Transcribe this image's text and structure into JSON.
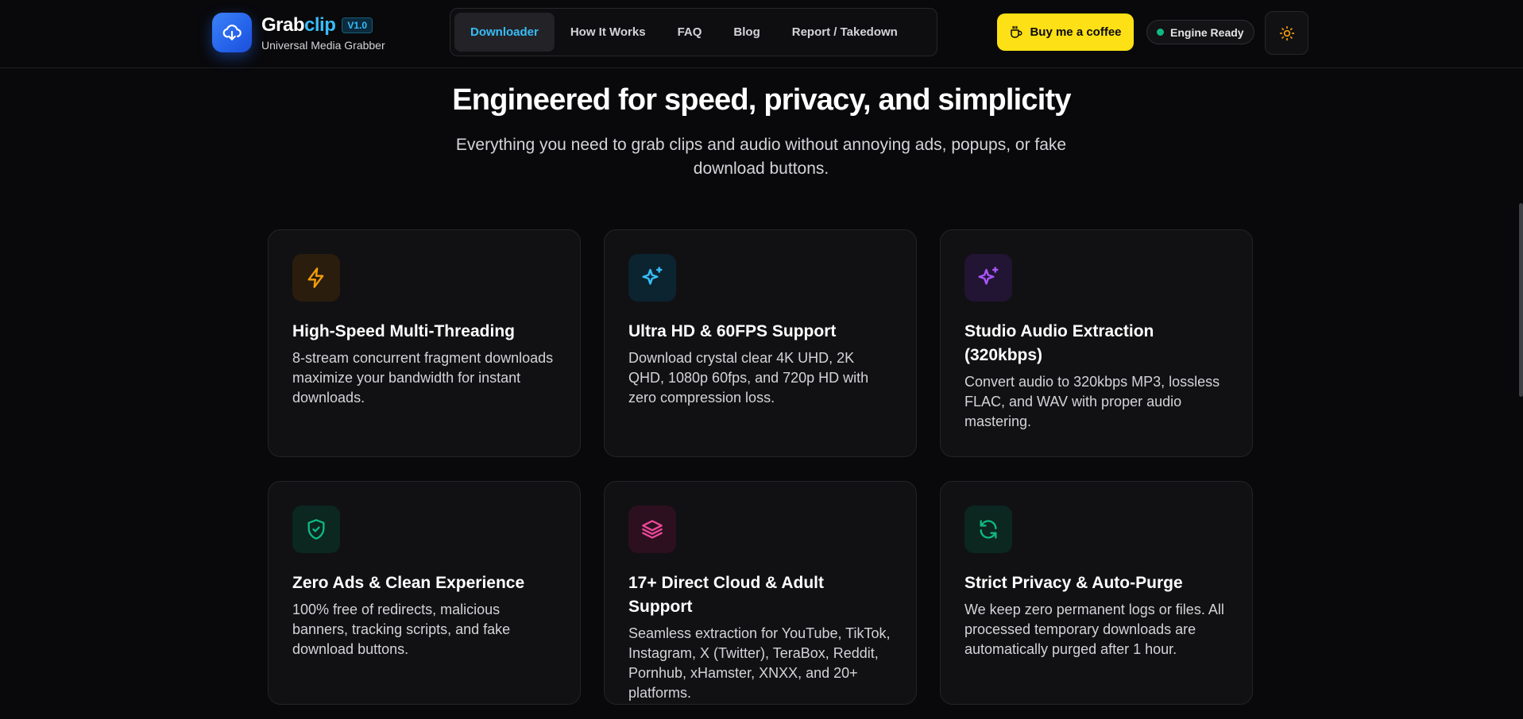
{
  "header": {
    "brand_name_part1": "Grab",
    "brand_name_part2": "clip",
    "version": "V1.0",
    "tagline": "Universal Media Grabber",
    "nav": [
      {
        "label": "Downloader",
        "active": true
      },
      {
        "label": "How It Works",
        "active": false
      },
      {
        "label": "FAQ",
        "active": false
      },
      {
        "label": "Blog",
        "active": false
      },
      {
        "label": "Report / Takedown",
        "active": false
      }
    ],
    "coffee_label": "Buy me a coffee",
    "engine_status": "Engine Ready"
  },
  "hero": {
    "title": "Engineered for speed, privacy, and simplicity",
    "subtitle": "Everything you need to grab clips and audio without annoying ads, popups, or fake download buttons."
  },
  "features": [
    {
      "icon": "lightning-icon",
      "color": "#f59e0b",
      "title": "High-Speed Multi-Threading",
      "desc": "8-stream concurrent fragment downloads maximize your bandwidth for instant downloads."
    },
    {
      "icon": "sparkles-icon",
      "color": "#38bdf8",
      "title": "Ultra HD & 60FPS Support",
      "desc": "Download crystal clear 4K UHD, 2K QHD, 1080p 60fps, and 720p HD with zero compression loss."
    },
    {
      "icon": "sparkles-icon",
      "color": "#a855f7",
      "title": "Studio Audio Extraction (320kbps)",
      "desc": "Convert audio to 320kbps MP3, lossless FLAC, and WAV with proper audio mastering."
    },
    {
      "icon": "shield-check-icon",
      "color": "#10b981",
      "title": "Zero Ads & Clean Experience",
      "desc": "100% free of redirects, malicious banners, tracking scripts, and fake download buttons."
    },
    {
      "icon": "layers-icon",
      "color": "#ec4899",
      "title": "17+ Direct Cloud & Adult Support",
      "desc": "Seamless extraction for YouTube, TikTok, Instagram, X (Twitter), TeraBox, Reddit, Pornhub, xHamster, XNXX, and 20+ platforms."
    },
    {
      "icon": "refresh-icon",
      "color": "#10b981",
      "title": "Strict Privacy & Auto-Purge",
      "desc": "We keep zero permanent logs or files. All processed temporary downloads are automatically purged after 1 hour."
    }
  ],
  "colors": {
    "accent": "#38bdf8",
    "coffee": "#fde015",
    "status_dot": "#10b981",
    "background": "#09090b"
  }
}
